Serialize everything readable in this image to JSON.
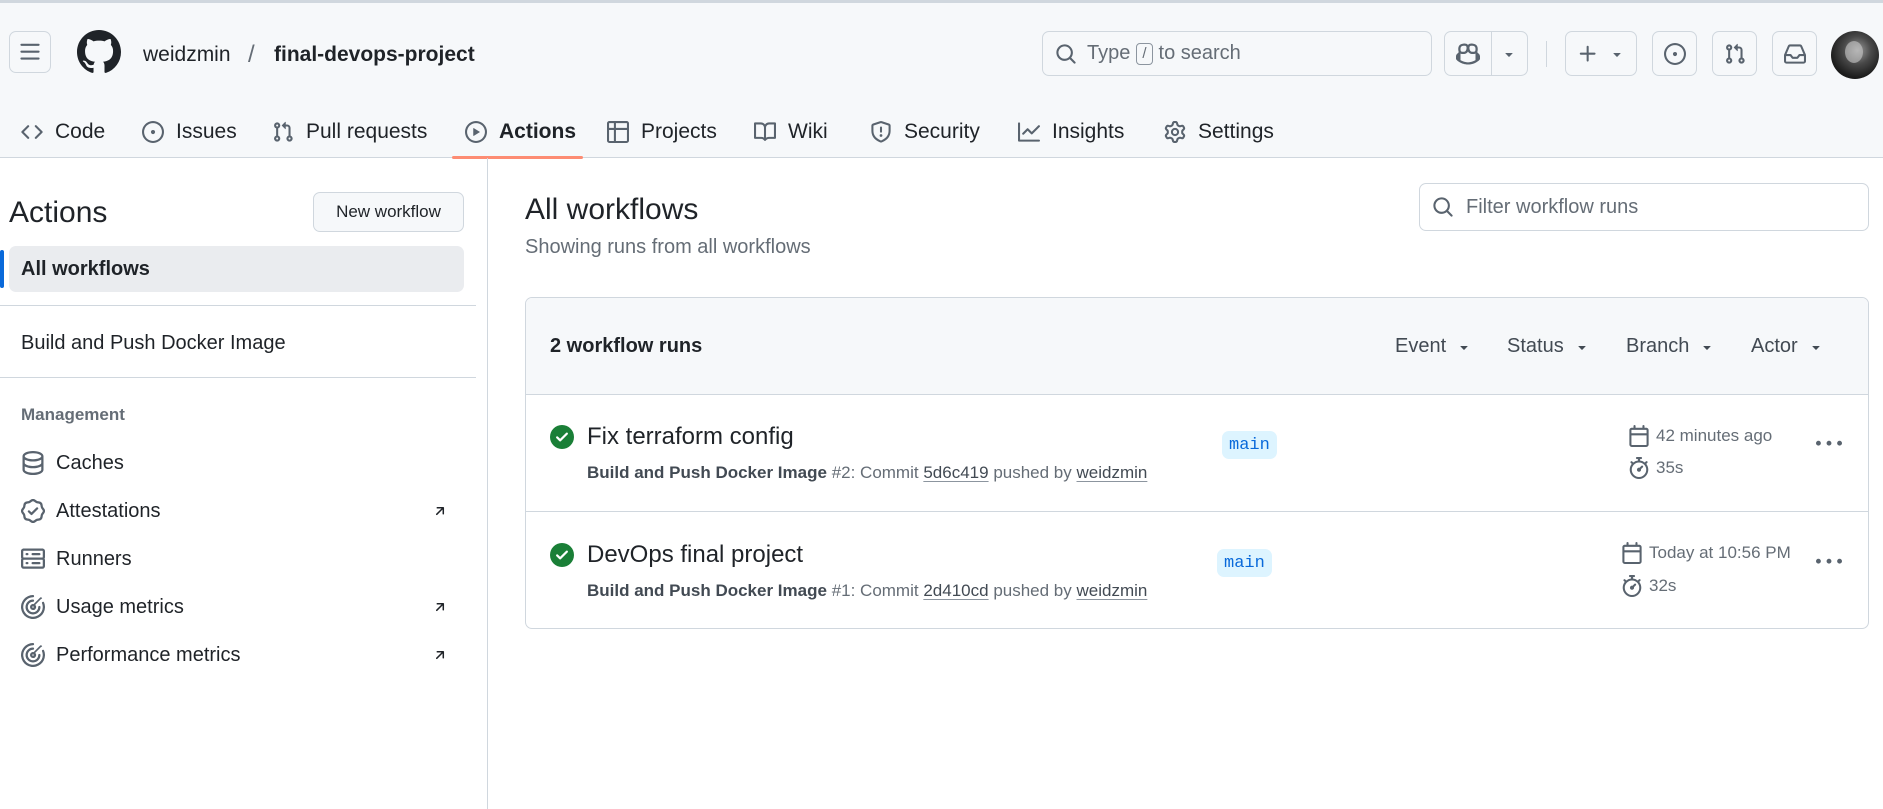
{
  "header": {
    "owner": "weidzmin",
    "separator": "/",
    "repo": "final-devops-project",
    "search": {
      "prefix": "Type",
      "key": "/",
      "suffix": "to search"
    },
    "icons": [
      "hamburger-icon",
      "github-logo-icon",
      "search-icon",
      "copilot-icon",
      "plus-icon",
      "issue-opened-icon",
      "pull-request-icon",
      "inbox-icon"
    ]
  },
  "tabs": [
    {
      "label": "Code",
      "icon": "code-icon"
    },
    {
      "label": "Issues",
      "icon": "issue-opened-icon"
    },
    {
      "label": "Pull requests",
      "icon": "pull-request-icon"
    },
    {
      "label": "Actions",
      "icon": "play-icon",
      "active": true
    },
    {
      "label": "Projects",
      "icon": "table-icon"
    },
    {
      "label": "Wiki",
      "icon": "book-icon"
    },
    {
      "label": "Security",
      "icon": "shield-icon"
    },
    {
      "label": "Insights",
      "icon": "graph-icon"
    },
    {
      "label": "Settings",
      "icon": "gear-icon"
    }
  ],
  "sidebar": {
    "title": "Actions",
    "new_workflow": "New workflow",
    "all_workflows": "All workflows",
    "workflow": "Build and Push Docker Image",
    "section": "Management",
    "items": [
      {
        "label": "Caches",
        "icon": "database-icon"
      },
      {
        "label": "Attestations",
        "icon": "verified-icon",
        "external": true
      },
      {
        "label": "Runners",
        "icon": "server-icon"
      },
      {
        "label": "Usage metrics",
        "icon": "meter-icon",
        "external": true
      },
      {
        "label": "Performance metrics",
        "icon": "meter-icon",
        "external": true
      }
    ]
  },
  "main": {
    "title": "All workflows",
    "subtitle": "Showing runs from all workflows",
    "filter_placeholder": "Filter workflow runs",
    "runs_count": "2 workflow runs",
    "filters": [
      "Event",
      "Status",
      "Branch",
      "Actor"
    ],
    "runs": [
      {
        "title": "Fix terraform config",
        "workflow": "Build and Push Docker Image",
        "run_prefix": "#2: Commit",
        "commit": "5d6c419",
        "pushed_by": "pushed by",
        "actor": "weidzmin",
        "branch": "main",
        "when": "42 minutes ago",
        "duration": "35s",
        "status": "success"
      },
      {
        "title": "DevOps final project",
        "workflow": "Build and Push Docker Image",
        "run_prefix": "#1: Commit",
        "commit": "2d410cd",
        "pushed_by": "pushed by",
        "actor": "weidzmin",
        "branch": "main",
        "when": "Today at 10:56 PM",
        "duration": "32s",
        "status": "success"
      }
    ]
  },
  "colors": {
    "success": "#1a7f37",
    "accent_underline": "#fd8c73",
    "branch_bg": "#ddf4ff",
    "branch_fg": "#0969da",
    "selected_bar": "#0969da"
  }
}
